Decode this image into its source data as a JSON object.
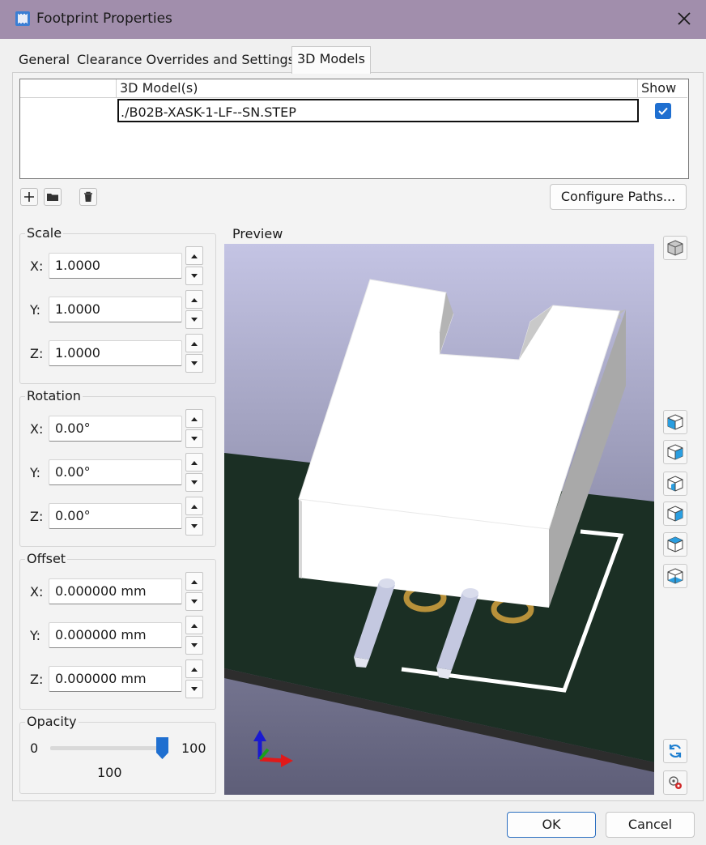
{
  "window": {
    "title": "Footprint Properties"
  },
  "tabs": [
    {
      "label": "General",
      "active": false
    },
    {
      "label": "Clearance Overrides and Settings",
      "active": false
    },
    {
      "label": "3D Models",
      "active": true
    }
  ],
  "models_table": {
    "columns": [
      "3D Model(s)",
      "Show"
    ],
    "rows": [
      {
        "path": "./B02B-XASK-1-LF--SN.STEP",
        "show": true
      }
    ]
  },
  "toolbar": {
    "add_icon": "plus-icon",
    "browse_icon": "folder-icon",
    "delete_icon": "trash-icon",
    "configure_paths_label": "Configure Paths..."
  },
  "scale": {
    "title": "Scale",
    "x_label": "X:",
    "x": "1.0000",
    "y_label": "Y:",
    "y": "1.0000",
    "z_label": "Z:",
    "z": "1.0000"
  },
  "rotation": {
    "title": "Rotation",
    "x_label": "X:",
    "x": "0.00°",
    "y_label": "Y:",
    "y": "0.00°",
    "z_label": "Z:",
    "z": "0.00°"
  },
  "offset": {
    "title": "Offset",
    "x_label": "X:",
    "x": "0.000000 mm",
    "y_label": "Y:",
    "y": "0.000000 mm",
    "z_label": "Z:",
    "z": "0.000000 mm"
  },
  "opacity": {
    "title": "Opacity",
    "min": "0",
    "max": "100",
    "value": "100",
    "fraction": 1.0
  },
  "preview": {
    "title": "Preview",
    "colors": {
      "bg_top": "#c4c4e4",
      "bg_bottom": "#5e5e78",
      "board": "#1b2f24",
      "board_edge": "#2a2a2a",
      "silkscreen": "#ffffff",
      "pad": "#b8913a",
      "body": "#ffffff",
      "body_side": "#a9a9a9",
      "pin": "#c4c8e0"
    },
    "side_icons": [
      "cube-perspective-icon",
      "view-front-icon",
      "view-back-icon",
      "view-left-icon",
      "view-right-icon",
      "view-top-icon",
      "view-bottom-icon",
      "reload-icon",
      "render-settings-icon"
    ]
  },
  "buttons": {
    "ok": "OK",
    "cancel": "Cancel"
  },
  "colors": {
    "accent": "#1f6fd0",
    "titlebar": "#a18eac",
    "ok_border": "#2b6fc0"
  }
}
